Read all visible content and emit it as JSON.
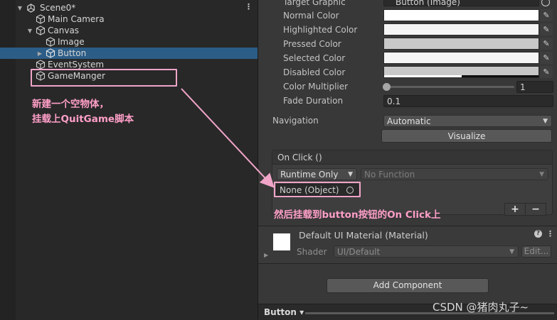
{
  "hierarchy": {
    "scene": "Scene0*",
    "items": [
      {
        "label": "Main Camera"
      },
      {
        "label": "Canvas"
      },
      {
        "label": "Image"
      },
      {
        "label": "Button"
      },
      {
        "label": "EventSystem"
      },
      {
        "label": "GameManger"
      }
    ]
  },
  "annotations": {
    "line1": "新建一个空物体，",
    "line2": "挂载上QuitGame脚本",
    "line3": "然后挂载到button按钮的On Click上"
  },
  "inspector": {
    "target_graphic_label": "Target Graphic",
    "target_graphic_value": "Button (Image)",
    "colors": [
      {
        "label": "Normal Color",
        "hex": "#ffffff"
      },
      {
        "label": "Highlighted Color",
        "hex": "#f5f5f5"
      },
      {
        "label": "Pressed Color",
        "hex": "#c8c8c8"
      },
      {
        "label": "Selected Color",
        "hex": "#f5f5f5"
      },
      {
        "label": "Disabled Color",
        "hex": "#c8c8c8"
      }
    ],
    "color_multiplier_label": "Color Multiplier",
    "color_multiplier_value": "1",
    "fade_duration_label": "Fade Duration",
    "fade_duration_value": "0.1",
    "navigation_label": "Navigation",
    "navigation_value": "Automatic",
    "visualize_label": "Visualize",
    "onclick_title": "On Click ()",
    "runtime_value": "Runtime Only",
    "function_value": "No Function",
    "object_value": "None (Object)",
    "plus_label": "+",
    "minus_label": "−",
    "material_title": "Default UI Material (Material)",
    "shader_label": "Shader",
    "shader_value": "UI/Default",
    "edit_label": "Edit...",
    "add_component_label": "Add Component",
    "bottom_label": "Button"
  },
  "watermark": "CSDN @猪肉丸子~"
}
